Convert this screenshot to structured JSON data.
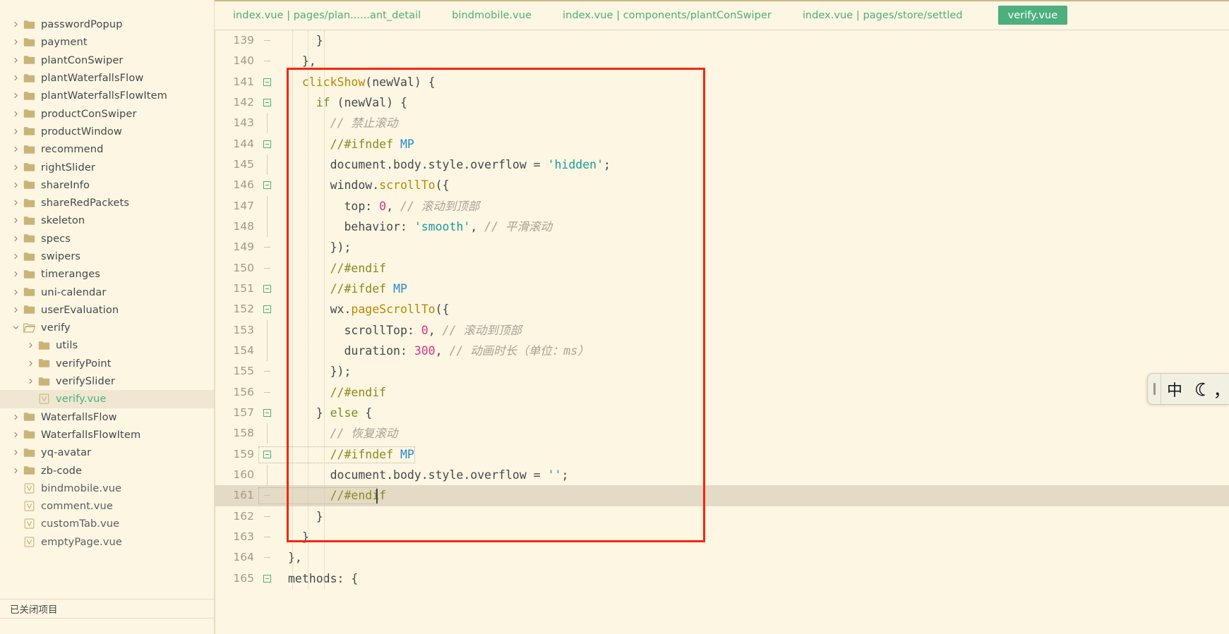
{
  "sidebar": {
    "items": [
      {
        "label": "passwordPopup",
        "type": "folder",
        "state": "collapsed",
        "depth": 1
      },
      {
        "label": "payment",
        "type": "folder",
        "state": "collapsed",
        "depth": 1
      },
      {
        "label": "plantConSwiper",
        "type": "folder",
        "state": "collapsed",
        "depth": 1
      },
      {
        "label": "plantWaterfallsFlow",
        "type": "folder",
        "state": "collapsed",
        "depth": 1
      },
      {
        "label": "plantWaterfallsFlowItem",
        "type": "folder",
        "state": "collapsed",
        "depth": 1
      },
      {
        "label": "productConSwiper",
        "type": "folder",
        "state": "collapsed",
        "depth": 1
      },
      {
        "label": "productWindow",
        "type": "folder",
        "state": "collapsed",
        "depth": 1
      },
      {
        "label": "recommend",
        "type": "folder",
        "state": "collapsed",
        "depth": 1
      },
      {
        "label": "rightSlider",
        "type": "folder",
        "state": "collapsed",
        "depth": 1
      },
      {
        "label": "shareInfo",
        "type": "folder",
        "state": "collapsed",
        "depth": 1
      },
      {
        "label": "shareRedPackets",
        "type": "folder",
        "state": "collapsed",
        "depth": 1
      },
      {
        "label": "skeleton",
        "type": "folder",
        "state": "collapsed",
        "depth": 1
      },
      {
        "label": "specs",
        "type": "folder",
        "state": "collapsed",
        "depth": 1
      },
      {
        "label": "swipers",
        "type": "folder",
        "state": "collapsed",
        "depth": 1
      },
      {
        "label": "timeranges",
        "type": "folder",
        "state": "collapsed",
        "depth": 1
      },
      {
        "label": "uni-calendar",
        "type": "folder",
        "state": "collapsed",
        "depth": 1
      },
      {
        "label": "userEvaluation",
        "type": "folder",
        "state": "collapsed",
        "depth": 1
      },
      {
        "label": "verify",
        "type": "folder",
        "state": "expanded",
        "depth": 1
      },
      {
        "label": "utils",
        "type": "folder",
        "state": "collapsed",
        "depth": 2
      },
      {
        "label": "verifyPoint",
        "type": "folder",
        "state": "collapsed",
        "depth": 2
      },
      {
        "label": "verifySlider",
        "type": "folder",
        "state": "collapsed",
        "depth": 2
      },
      {
        "label": "verify.vue",
        "type": "vue",
        "state": "selected",
        "depth": 2
      },
      {
        "label": "WaterfallsFlow",
        "type": "folder",
        "state": "collapsed",
        "depth": 1
      },
      {
        "label": "WaterfallsFlowItem",
        "type": "folder",
        "state": "collapsed",
        "depth": 1
      },
      {
        "label": "yq-avatar",
        "type": "folder",
        "state": "collapsed",
        "depth": 1
      },
      {
        "label": "zb-code",
        "type": "folder",
        "state": "collapsed",
        "depth": 1
      },
      {
        "label": "bindmobile.vue",
        "type": "vue",
        "state": "normal",
        "depth": 1
      },
      {
        "label": "comment.vue",
        "type": "vue",
        "state": "normal",
        "depth": 1
      },
      {
        "label": "customTab.vue",
        "type": "vue",
        "state": "normal",
        "depth": 1
      },
      {
        "label": "emptyPage.vue",
        "type": "vue",
        "state": "normal",
        "depth": 1
      }
    ],
    "closed_projects_label": "已关闭项目"
  },
  "tabs": [
    {
      "label": "index.vue | pages/plan......ant_detail",
      "active": false
    },
    {
      "label": "bindmobile.vue",
      "active": false
    },
    {
      "label": "index.vue | components/plantConSwiper",
      "active": false
    },
    {
      "label": "index.vue | pages/store/settled",
      "active": false
    },
    {
      "label": "verify.vue",
      "active": true
    }
  ],
  "editor": {
    "first_line": 139,
    "current_line": 161,
    "lines": [
      {
        "n": 139,
        "fold": "tick",
        "indent": 0,
        "tokens": [
          {
            "t": "    }",
            "c": "pl"
          }
        ]
      },
      {
        "n": 140,
        "fold": "tick",
        "indent": 0,
        "tokens": [
          {
            "t": "  },",
            "c": "pl"
          }
        ]
      },
      {
        "n": 141,
        "fold": "box",
        "indent": 0,
        "tokens": [
          {
            "t": "  ",
            "c": "pl"
          },
          {
            "t": "clickShow",
            "c": "fn"
          },
          {
            "t": "(newVal) {",
            "c": "pl"
          }
        ]
      },
      {
        "n": 142,
        "fold": "box",
        "indent": 0,
        "tokens": [
          {
            "t": "    ",
            "c": "pl"
          },
          {
            "t": "if",
            "c": "k"
          },
          {
            "t": " (newVal) {",
            "c": "pl"
          }
        ]
      },
      {
        "n": 143,
        "fold": "dash",
        "indent": 0,
        "tokens": [
          {
            "t": "      ",
            "c": "pl"
          },
          {
            "t": "// 禁止滚动",
            "c": "cm"
          }
        ]
      },
      {
        "n": 144,
        "fold": "box",
        "indent": 0,
        "tokens": [
          {
            "t": "      ",
            "c": "pl"
          },
          {
            "t": "//#ifndef ",
            "c": "pp"
          },
          {
            "t": "MP",
            "c": "mp"
          }
        ]
      },
      {
        "n": 145,
        "fold": "dash",
        "indent": 0,
        "tokens": [
          {
            "t": "      document.body.style.overflow = ",
            "c": "pl"
          },
          {
            "t": "'hidden'",
            "c": "st"
          },
          {
            "t": ";",
            "c": "pl"
          }
        ]
      },
      {
        "n": 146,
        "fold": "box",
        "indent": 0,
        "tokens": [
          {
            "t": "      window.",
            "c": "pl"
          },
          {
            "t": "scrollTo",
            "c": "fn"
          },
          {
            "t": "({",
            "c": "pl"
          }
        ]
      },
      {
        "n": 147,
        "fold": "dash",
        "indent": 0,
        "tokens": [
          {
            "t": "        top: ",
            "c": "pl"
          },
          {
            "t": "0",
            "c": "num"
          },
          {
            "t": ", ",
            "c": "pl"
          },
          {
            "t": "// 滚动到顶部",
            "c": "cm"
          }
        ]
      },
      {
        "n": 148,
        "fold": "dash",
        "indent": 0,
        "tokens": [
          {
            "t": "        behavior: ",
            "c": "pl"
          },
          {
            "t": "'smooth'",
            "c": "st"
          },
          {
            "t": ", ",
            "c": "pl"
          },
          {
            "t": "// 平滑滚动",
            "c": "cm"
          }
        ]
      },
      {
        "n": 149,
        "fold": "tick",
        "indent": 0,
        "tokens": [
          {
            "t": "      });",
            "c": "pl"
          }
        ]
      },
      {
        "n": 150,
        "fold": "tick",
        "indent": 0,
        "tokens": [
          {
            "t": "      ",
            "c": "pl"
          },
          {
            "t": "//#endif",
            "c": "pp"
          }
        ]
      },
      {
        "n": 151,
        "fold": "box",
        "indent": 0,
        "tokens": [
          {
            "t": "      ",
            "c": "pl"
          },
          {
            "t": "//#ifdef ",
            "c": "pp"
          },
          {
            "t": "MP",
            "c": "mp"
          }
        ]
      },
      {
        "n": 152,
        "fold": "box",
        "indent": 0,
        "tokens": [
          {
            "t": "      wx.",
            "c": "pl"
          },
          {
            "t": "pageScrollTo",
            "c": "fn"
          },
          {
            "t": "({",
            "c": "pl"
          }
        ]
      },
      {
        "n": 153,
        "fold": "dash",
        "indent": 0,
        "tokens": [
          {
            "t": "        scrollTop: ",
            "c": "pl"
          },
          {
            "t": "0",
            "c": "num"
          },
          {
            "t": ", ",
            "c": "pl"
          },
          {
            "t": "// 滚动到顶部",
            "c": "cm"
          }
        ]
      },
      {
        "n": 154,
        "fold": "dash",
        "indent": 0,
        "tokens": [
          {
            "t": "        duration: ",
            "c": "pl"
          },
          {
            "t": "300",
            "c": "num"
          },
          {
            "t": ", ",
            "c": "pl"
          },
          {
            "t": "// 动画时长（单位：ms）",
            "c": "cm"
          }
        ]
      },
      {
        "n": 155,
        "fold": "tick",
        "indent": 0,
        "tokens": [
          {
            "t": "      });",
            "c": "pl"
          }
        ]
      },
      {
        "n": 156,
        "fold": "tick",
        "indent": 0,
        "tokens": [
          {
            "t": "      ",
            "c": "pl"
          },
          {
            "t": "//#endif",
            "c": "pp"
          }
        ]
      },
      {
        "n": 157,
        "fold": "box",
        "indent": 0,
        "tokens": [
          {
            "t": "    } ",
            "c": "pl"
          },
          {
            "t": "else",
            "c": "k"
          },
          {
            "t": " {",
            "c": "pl"
          }
        ]
      },
      {
        "n": 158,
        "fold": "dash",
        "indent": 0,
        "tokens": [
          {
            "t": "      ",
            "c": "pl"
          },
          {
            "t": "// 恢复滚动",
            "c": "cm"
          }
        ]
      },
      {
        "n": 159,
        "fold": "box",
        "indent": 0,
        "tokens": [
          {
            "t": "      ",
            "c": "pl"
          },
          {
            "t": "//#ifndef ",
            "c": "pp"
          },
          {
            "t": "MP",
            "c": "mp"
          }
        ]
      },
      {
        "n": 160,
        "fold": "dash",
        "indent": 0,
        "tokens": [
          {
            "t": "      document.body.style.overflow = ",
            "c": "pl"
          },
          {
            "t": "''",
            "c": "st"
          },
          {
            "t": ";",
            "c": "pl"
          }
        ]
      },
      {
        "n": 161,
        "fold": "tick",
        "indent": 0,
        "tokens": [
          {
            "t": "      ",
            "c": "pl"
          },
          {
            "t": "//#endif",
            "c": "pp"
          }
        ]
      },
      {
        "n": 162,
        "fold": "tick",
        "indent": 0,
        "tokens": [
          {
            "t": "    }",
            "c": "pl"
          }
        ]
      },
      {
        "n": 163,
        "fold": "tick",
        "indent": 0,
        "tokens": [
          {
            "t": "  }",
            "c": "pl"
          }
        ]
      },
      {
        "n": 164,
        "fold": "tick",
        "indent": 0,
        "tokens": [
          {
            "t": "},",
            "c": "pl"
          }
        ]
      },
      {
        "n": 165,
        "fold": "box",
        "indent": 0,
        "tokens": [
          {
            "t": "methods: {",
            "c": "pl"
          }
        ]
      }
    ]
  },
  "annotation": {
    "type": "red-rectangle",
    "color": "#f92405",
    "covers_lines": "141-163"
  },
  "ime": {
    "mode_label": "中",
    "moon_icon": "moon-icon",
    "punctuation_label": "，"
  }
}
